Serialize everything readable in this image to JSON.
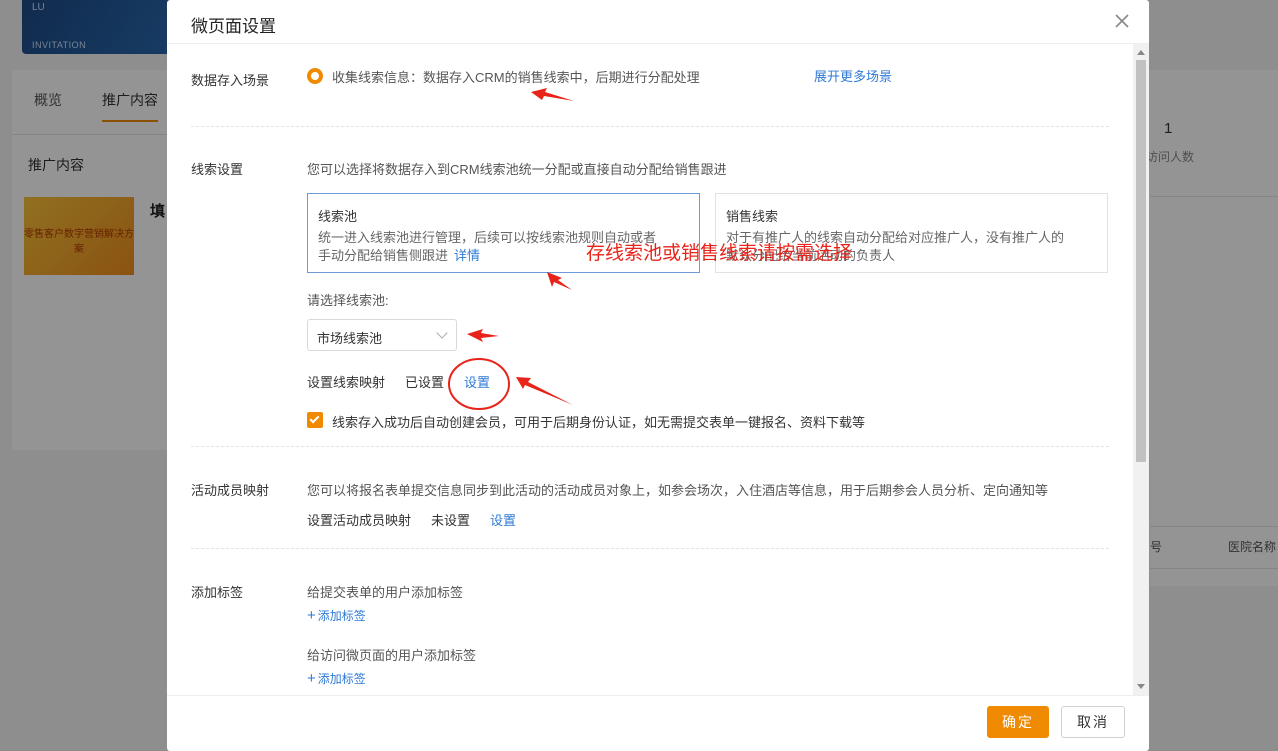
{
  "background": {
    "banner_line1": "LU",
    "banner_line2": "INVITATION",
    "tabs": [
      "概览",
      "推广内容"
    ],
    "section_title": "推广内容",
    "thumb_text": "零售客户数字营销解决方案",
    "fill_text": "填",
    "stat_number": "1",
    "stat_label": "访问人数",
    "col_header_1": "号",
    "col_header_2": "医院名称"
  },
  "modal": {
    "title": "微页面设置",
    "data_scene": {
      "label": "数据存入场景",
      "option_text": "收集线索信息：数据存入CRM的销售线索中，后期进行分配处理",
      "more_link": "展开更多场景"
    },
    "lead_settings": {
      "label": "线索设置",
      "description": "您可以选择将数据存入到CRM线索池统一分配或直接自动分配给销售跟进",
      "pool_card": {
        "title": "线索池",
        "desc_line1": "统一进入线索池进行管理，后续可以按线索池规则自动或者",
        "desc_line2": "手动分配给销售侧跟进",
        "detail_link": "详情"
      },
      "sales_card": {
        "title": "销售线索",
        "desc_line1": "对于有推广人的线索自动分配给对应推广人，没有推广人的",
        "desc_line2": "默认分配给当前活动的负责人"
      },
      "pool_select_label": "请选择线索池:",
      "pool_select_value": "市场线索池",
      "mapping_label": "设置线索映射",
      "mapping_status": "已设置",
      "mapping_link": "设置",
      "auto_member_text": "线索存入成功后自动创建会员，可用于后期身份认证，如无需提交表单一键报名、资料下载等"
    },
    "member_mapping": {
      "label": "活动成员映射",
      "description": "您可以将报名表单提交信息同步到此活动的活动成员对象上，如参会场次，入住酒店等信息，用于后期参会人员分析、定向通知等",
      "mapping_label": "设置活动成员映射",
      "mapping_status": "未设置",
      "mapping_link": "设置"
    },
    "tags": {
      "label": "添加标签",
      "submit_users_label": "给提交表单的用户添加标签",
      "add_tag_1": "添加标签",
      "visit_users_label": "给访问微页面的用户添加标签",
      "add_tag_2": "添加标签"
    },
    "annotation": "存线索池或销售线索请按需选择",
    "footer": {
      "ok": "确定",
      "cancel": "取消"
    }
  },
  "colors": {
    "accent": "#f08a00",
    "link": "#2f7ad6",
    "annotation": "#e8241a"
  }
}
